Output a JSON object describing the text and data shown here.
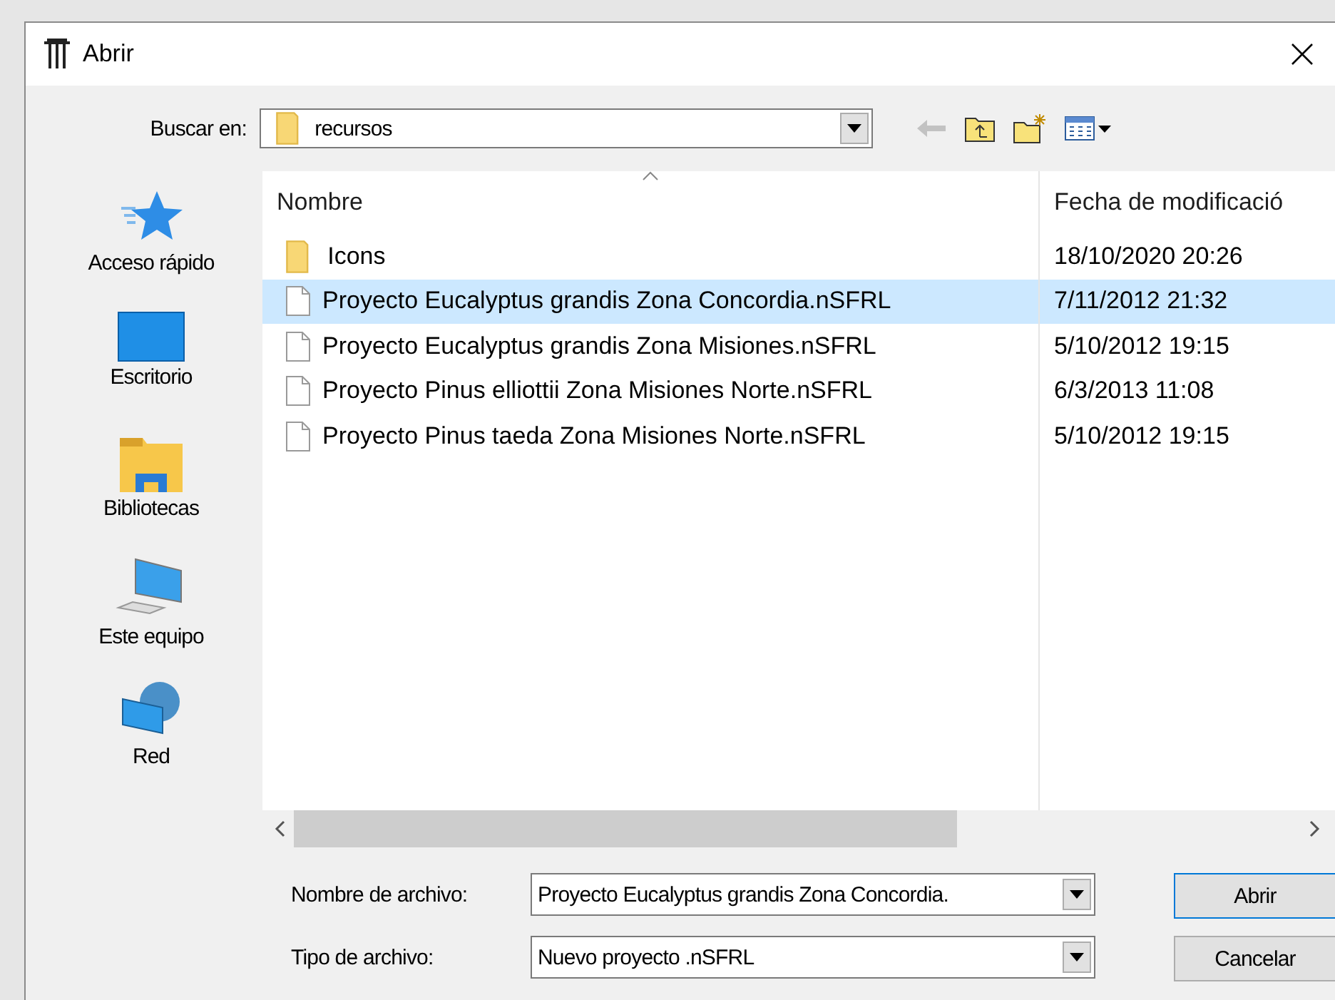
{
  "window": {
    "title": "Abrir"
  },
  "look_in": {
    "label": "Buscar en:",
    "value": "recursos"
  },
  "toolbar": [
    {
      "kind": "back",
      "disabled": true
    },
    {
      "kind": "up",
      "disabled": false
    },
    {
      "kind": "newfolder",
      "disabled": false
    },
    {
      "kind": "view",
      "disabled": false
    }
  ],
  "places": [
    {
      "kind": "star",
      "label": "Acceso rápido"
    },
    {
      "kind": "desktop",
      "label": "Escritorio"
    },
    {
      "kind": "library",
      "label": "Bibliotecas"
    },
    {
      "kind": "computer",
      "label": "Este equipo"
    },
    {
      "kind": "network",
      "label": "Red"
    }
  ],
  "table": {
    "columns": [
      "Nombre",
      "Fecha de modificació"
    ],
    "rows": [
      {
        "kind": "folder",
        "name": "Icons",
        "date": "18/10/2020 20:26",
        "selected": false
      },
      {
        "kind": "file",
        "name": "Proyecto Eucalyptus grandis Zona Concordia.nSFRL",
        "date": "7/11/2012 21:32",
        "selected": true
      },
      {
        "kind": "file",
        "name": "Proyecto Eucalyptus grandis Zona Misiones.nSFRL",
        "date": "5/10/2012 19:15",
        "selected": false
      },
      {
        "kind": "file",
        "name": "Proyecto Pinus elliottii Zona Misiones Norte.nSFRL",
        "date": "6/3/2013 11:08",
        "selected": false
      },
      {
        "kind": "file",
        "name": "Proyecto Pinus taeda Zona Misiones Norte.nSFRL",
        "date": "5/10/2012 19:15",
        "selected": false
      }
    ]
  },
  "file_name": {
    "label": "Nombre de archivo:",
    "value": "Proyecto Eucalyptus grandis Zona Concordia."
  },
  "file_type": {
    "label": "Tipo de archivo:",
    "value": "Nuevo proyecto .nSFRL"
  },
  "buttons": [
    "Abrir",
    "Cancelar"
  ]
}
